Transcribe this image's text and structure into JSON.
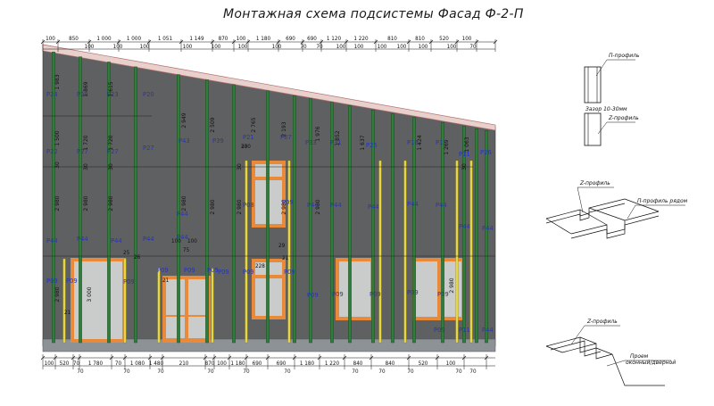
{
  "title": "Монтажная схема подсистемы Фасад Ф-2-П",
  "top_dims": [
    "100",
    "850",
    "1 000",
    "1 000",
    "1 051",
    "1 149",
    "870",
    "100",
    "1 180",
    "690",
    "690",
    "1 120",
    "1 220",
    "810",
    "810",
    "520",
    "100"
  ],
  "top_sub_dims": [
    "100",
    "100",
    "100",
    "100",
    "100",
    "100",
    "100",
    "70",
    "70",
    "100",
    "100",
    "100",
    "100",
    "100",
    "100",
    "70"
  ],
  "bottom_dims": [
    "100",
    "520",
    "70",
    "1 780",
    "70",
    "1 080",
    "1 480",
    "210",
    "870",
    "100",
    "1 180",
    "690",
    "690",
    "1 180",
    "1 220",
    "840",
    "840",
    "520",
    "100"
  ],
  "bottom_sub_dims": [
    "70",
    "70",
    "70",
    "70",
    "70",
    "70",
    "70",
    "70",
    "70",
    "70",
    "70"
  ],
  "vertical_dims": [
    "1 983",
    "1 500",
    "2 980",
    "2 980",
    "1 869",
    "1 720",
    "2 980",
    "1 615",
    "1 720",
    "2 980",
    "2 949",
    "2 980",
    "2 509",
    "2 980",
    "2 765",
    "2 980",
    "2 193",
    "2 980",
    "1 976",
    "2 980",
    "1 852",
    "1 637",
    "1 424",
    "1 269",
    "1 063",
    "2 980",
    "3 000",
    "30",
    "30",
    "30",
    "30",
    "30"
  ],
  "panel_labels": [
    "P24",
    "P29",
    "P23",
    "P20",
    "P22",
    "P27",
    "P27",
    "P27",
    "P43",
    "P39",
    "P21",
    "P07",
    "P33",
    "P31",
    "P25",
    "P16",
    "P15",
    "P11",
    "P26",
    "P44",
    "P44",
    "P08",
    "P09",
    "P44",
    "P44",
    "P44",
    "P44",
    "P44",
    "P44",
    "P44",
    "P44",
    "P44",
    "P44",
    "P44",
    "P09",
    "P09",
    "P09",
    "P09",
    "P09",
    "P09",
    "P09",
    "P09",
    "P09",
    "P09",
    "P09",
    "P09",
    "P09",
    "P09",
    "P11",
    "P09",
    "P44"
  ],
  "small_dims": [
    "21",
    "25",
    "100",
    "75",
    "100",
    "21",
    "29",
    "228",
    "21",
    "33",
    "200",
    "26"
  ],
  "legend_top": {
    "p_profile": "П-профиль",
    "gap": "Зазор 10-30мм",
    "z_profile": "Z-профиль"
  },
  "legend_mid": {
    "z_profile": "Z-профиль",
    "p_profile_row": "П-профиль рядом"
  },
  "legend_bot": {
    "z_profile": "Z-профиль",
    "opening_l1": "Проем",
    "opening_l2": "оконный/дверной"
  },
  "colors": {
    "wall": "#5f6061",
    "roof_band": "#e8d0cc",
    "roof_line": "#b87070",
    "profile_green": "#2f7d3a",
    "profile_yellow": "#e6d640",
    "window_frame": "#e88a3a",
    "glass": "#c9ccca",
    "label_blue": "#1f33d6",
    "base_band": "#8d9296"
  }
}
